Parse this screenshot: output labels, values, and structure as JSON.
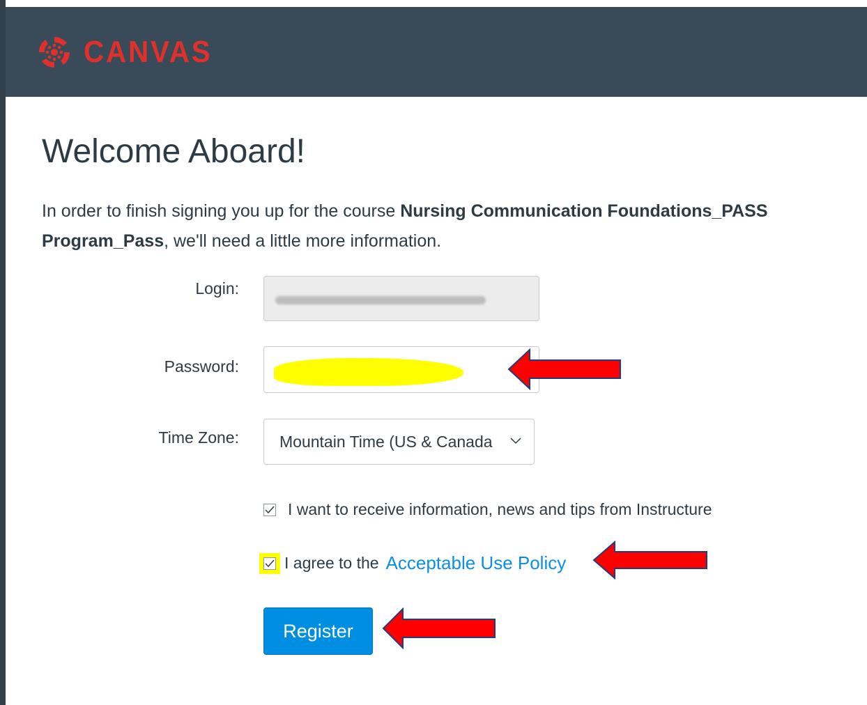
{
  "header": {
    "brand": "CANVAS",
    "logo_icon": "canvas-logo-icon",
    "background_color": "#394b58",
    "brand_color": "#e0302c"
  },
  "page": {
    "title": "Welcome Aboard!",
    "intro_prefix": "In order to finish signing you up for the course ",
    "course_name": "Nursing Communication Foundations_PASS Program_Pass",
    "intro_suffix": ", we'll need a little more information."
  },
  "form": {
    "login_label": "Login:",
    "password_label": "Password:",
    "timezone_label": "Time Zone:",
    "timezone_value": "Mountain Time (US & Canada",
    "newsletter_label": "I want to receive information, news and tips from Instructure",
    "newsletter_checked": true,
    "agree_prefix": "I agree to the",
    "agree_link": "Acceptable Use Policy",
    "agree_checked": true,
    "register_label": "Register"
  },
  "annotations": {
    "arrow_color": "#ff0000",
    "highlight_color": "#ffff00"
  }
}
